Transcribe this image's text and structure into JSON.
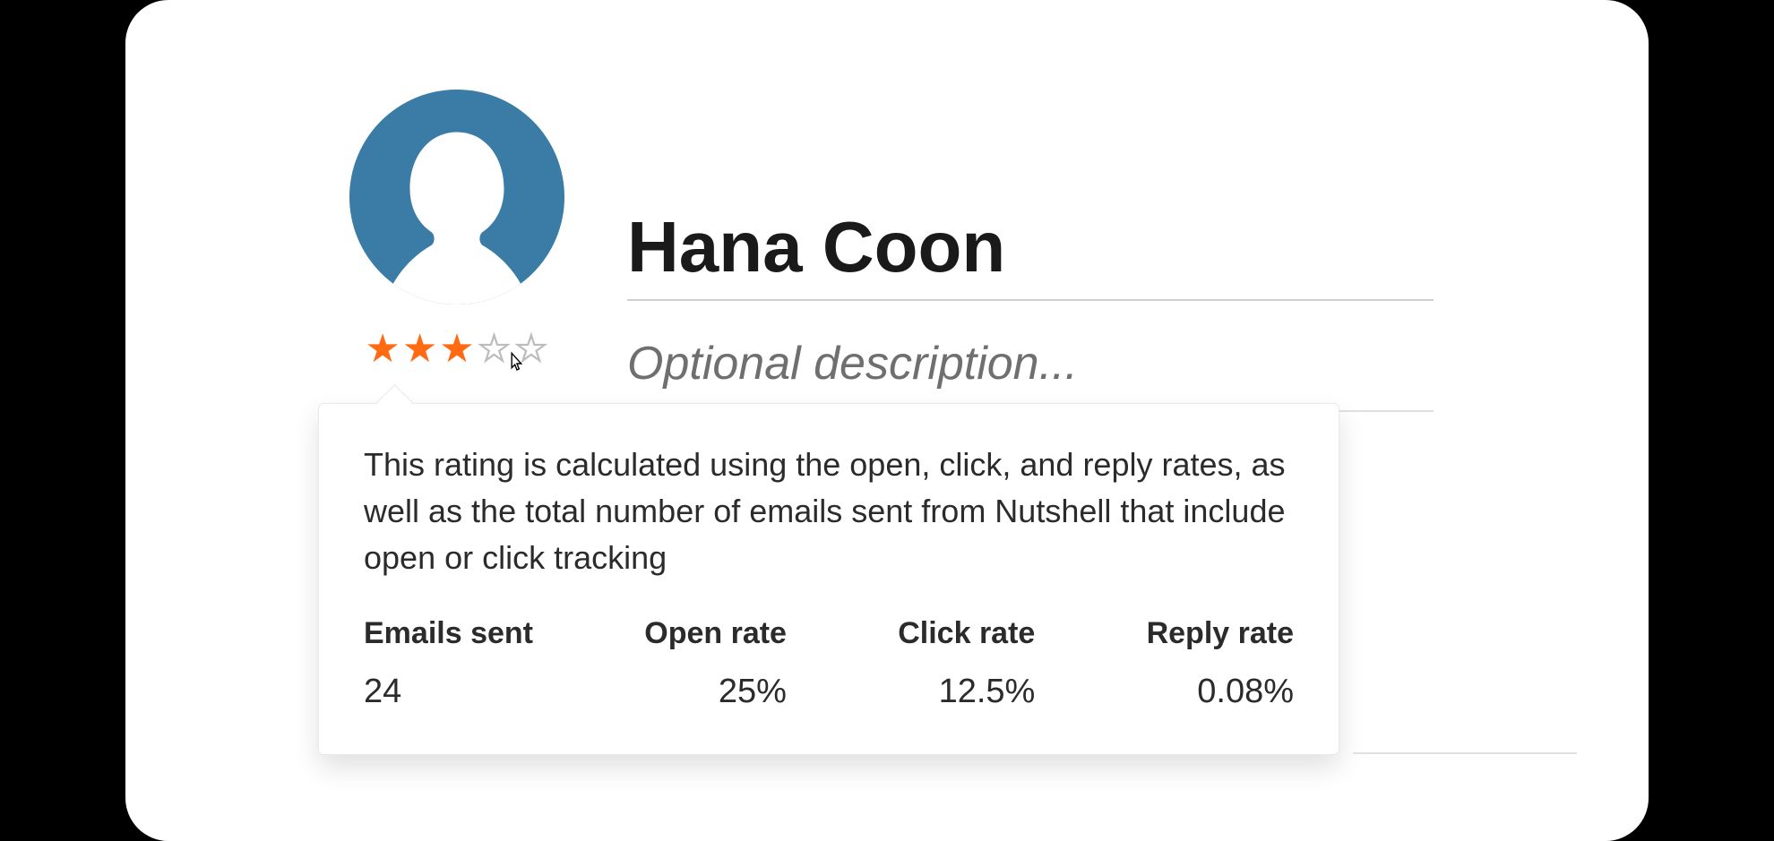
{
  "contact": {
    "name": "Hana Coon",
    "description_placeholder": "Optional description...",
    "rating": {
      "filled": 3,
      "total": 5
    }
  },
  "tooltip": {
    "text": "This rating is calculated using the open, click, and reply rates, as well as the total number of emails sent from Nutshell that include open or click tracking",
    "stats": [
      {
        "label": "Emails sent",
        "value": "24"
      },
      {
        "label": "Open rate",
        "value": "25%"
      },
      {
        "label": "Click rate",
        "value": "12.5%"
      },
      {
        "label": "Reply rate",
        "value": "0.08%"
      }
    ]
  },
  "colors": {
    "avatar_bg": "#3a7ca5",
    "star_filled": "#ff6a13",
    "star_empty": "#c8c8c8"
  }
}
